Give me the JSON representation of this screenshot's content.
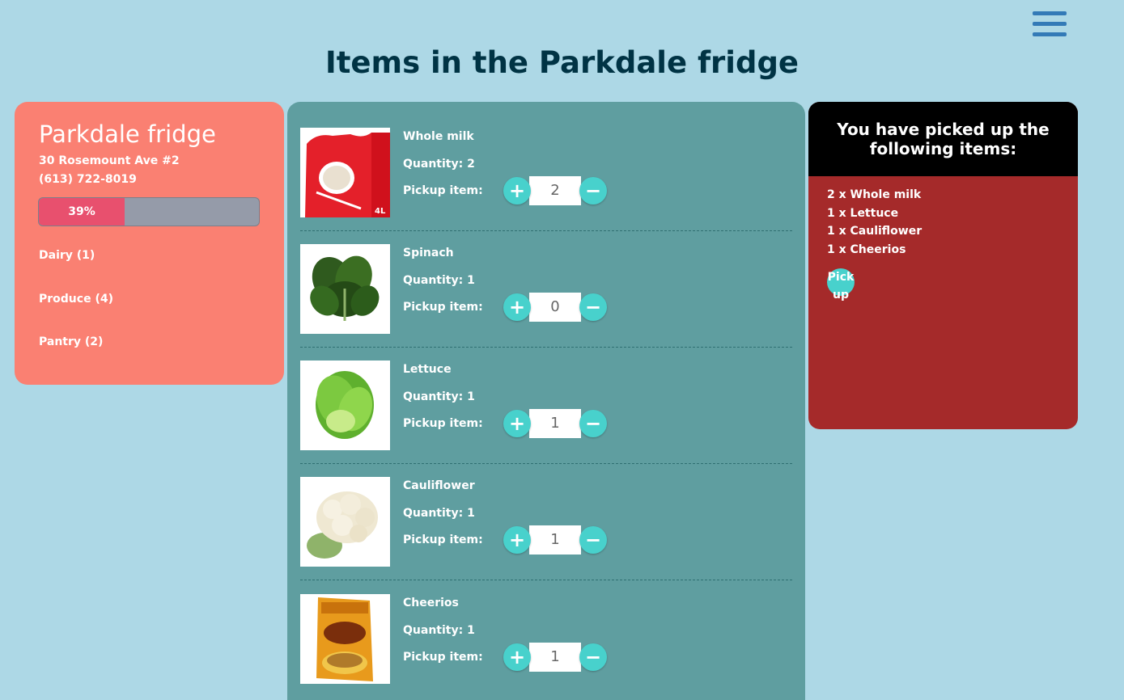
{
  "header": {
    "title": "Items in the Parkdale fridge",
    "menu_icon": "hamburger-icon"
  },
  "fridge": {
    "name": "Parkdale fridge",
    "address": "30 Rosemount Ave #2",
    "phone": "(613) 722-8019",
    "capacity_label": "39%",
    "capacity_fraction": 0.39,
    "categories": [
      {
        "label": "Dairy (1)"
      },
      {
        "label": "Produce (4)"
      },
      {
        "label": "Pantry (2)"
      }
    ]
  },
  "items": [
    {
      "name": "Whole milk",
      "quantity": "Quantity: 2",
      "pickup_label": "Pickup item:",
      "pickup_value": "2",
      "image": "milk-bag"
    },
    {
      "name": "Spinach",
      "quantity": "Quantity: 1",
      "pickup_label": "Pickup item:",
      "pickup_value": "0",
      "image": "spinach"
    },
    {
      "name": "Lettuce",
      "quantity": "Quantity: 1",
      "pickup_label": "Pickup item:",
      "pickup_value": "1",
      "image": "lettuce"
    },
    {
      "name": "Cauliflower",
      "quantity": "Quantity: 1",
      "pickup_label": "Pickup item:",
      "pickup_value": "1",
      "image": "cauliflower"
    },
    {
      "name": "Cheerios",
      "quantity": "Quantity: 1",
      "pickup_label": "Pickup item:",
      "pickup_value": "1",
      "image": "cheerios-box"
    }
  ],
  "picked": {
    "header": "You have picked up the following items:",
    "items": [
      "2 x Whole milk",
      "1 x Lettuce",
      "1 x Cauliflower",
      "1 x Cheerios"
    ],
    "button_label": "Pick up"
  },
  "colors": {
    "background": "#add8e6",
    "fridge_card": "#fa8072",
    "items_panel": "#5f9ea0",
    "picked_card": "#a52a2a",
    "accent": "#48d1cc",
    "progress_fill": "#e8506e"
  }
}
